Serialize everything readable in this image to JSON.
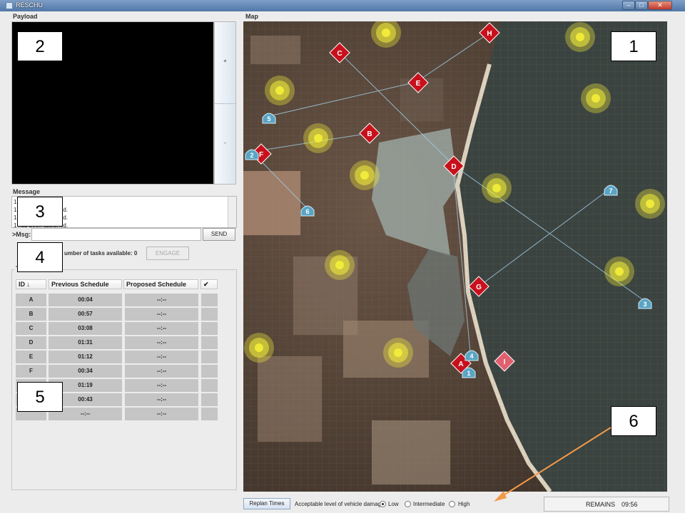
{
  "window": {
    "title": "RESCHU",
    "min": "–",
    "max": "□",
    "close": "✕"
  },
  "payload": {
    "label": "Payload",
    "zoom_in": "+",
    "zoom_out": "-"
  },
  "message": {
    "label": "Message",
    "lines": [
      "1 Started",
      "1 has been assigned.",
      "1 has been assigned.",
      "1 has been assigned."
    ],
    "prompt": ">Msg:",
    "input_value": "",
    "send": "SEND"
  },
  "engage": {
    "count_text": "umber of tasks available: 0",
    "button": "ENGAGE"
  },
  "tasks": {
    "label": "T",
    "columns": [
      "ID ↓",
      "Previous Schedule",
      "Proposed Schedule",
      "✔"
    ],
    "rows": [
      {
        "id": "A",
        "prev": "00:04",
        "prop": "--:--"
      },
      {
        "id": "B",
        "prev": "00:57",
        "prop": "--:--"
      },
      {
        "id": "C",
        "prev": "03:08",
        "prop": "--:--"
      },
      {
        "id": "D",
        "prev": "01:31",
        "prop": "--:--"
      },
      {
        "id": "E",
        "prev": "01:12",
        "prop": "--:--"
      },
      {
        "id": "F",
        "prev": "00:34",
        "prop": "--:--"
      },
      {
        "id": "",
        "prev": "01:19",
        "prop": "--:--"
      },
      {
        "id": "",
        "prev": "00:43",
        "prop": "--:--"
      },
      {
        "id": "",
        "prev": "--:--",
        "prop": "--:--"
      }
    ]
  },
  "map": {
    "label": "Map",
    "targets": [
      "A",
      "B",
      "C",
      "D",
      "E",
      "F",
      "G",
      "H",
      "I"
    ],
    "uavs": [
      "1",
      "2",
      "3",
      "4",
      "5",
      "6",
      "7"
    ]
  },
  "bottom": {
    "replan": "Replan Times",
    "damage_label": "Acceptable level of vehicle damage",
    "options": [
      "Low",
      "Intermediate",
      "High"
    ],
    "selected": "Low",
    "remains_label": "REMAINS",
    "remains_time": "09:56"
  },
  "overlays": [
    "1",
    "2",
    "3",
    "4",
    "5",
    "6"
  ],
  "colors": {
    "target": "#c8101c",
    "uav": "#5aa4c4",
    "hazard": "#f4ee3a",
    "arrow": "#f39a4a"
  }
}
